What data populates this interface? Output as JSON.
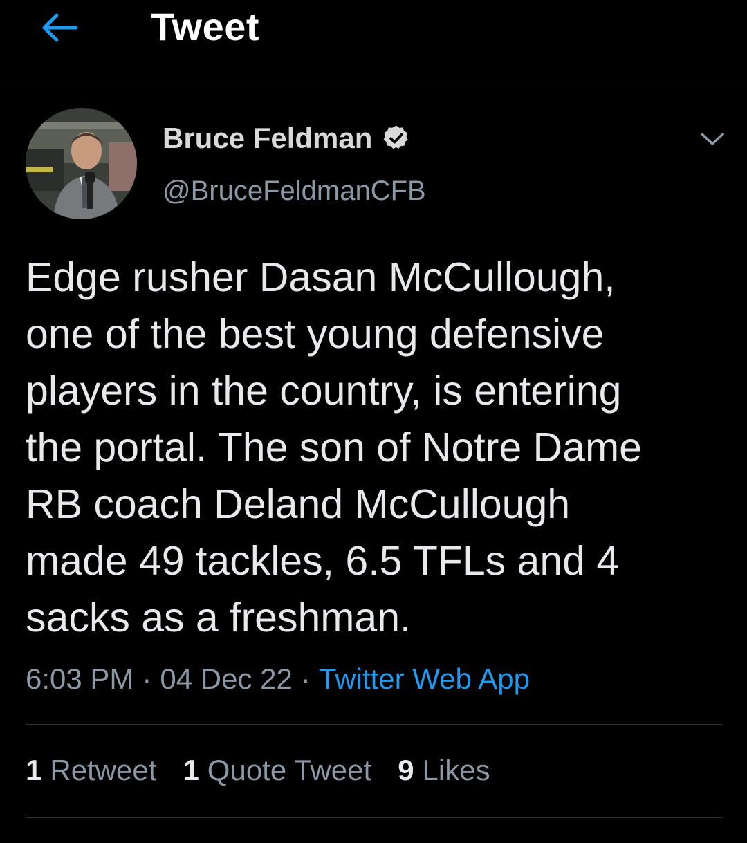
{
  "header": {
    "title": "Tweet",
    "back_icon": "arrow-left-icon",
    "accent_color": "#1d9bf0"
  },
  "author": {
    "name": "Bruce Feldman",
    "handle": "@BruceFeldmanCFB",
    "verified_icon": "verified-badge-icon",
    "more_icon": "chevron-down-icon"
  },
  "tweet": {
    "text": "Edge rusher Dasan McCullough,\none of the best young defensive\nplayers in the country, is entering\nthe portal. The son of Notre Dame\nRB coach Deland McCullough\nmade 49 tackles, 6.5 TFLs and 4\nsacks as a freshman.",
    "time": "6:03 PM",
    "date": "04 Dec 22",
    "separator": "·",
    "source": "Twitter Web App"
  },
  "stats": {
    "retweets_count": "1",
    "retweets_label": "Retweet",
    "quotes_count": "1",
    "quotes_label": "Quote Tweet",
    "likes_count": "9",
    "likes_label": "Likes"
  }
}
